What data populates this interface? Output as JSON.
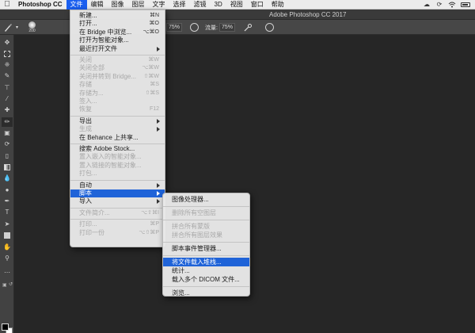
{
  "menubar": {
    "app_name": "Photoshop CC",
    "items": [
      "文件",
      "编辑",
      "图像",
      "图层",
      "文字",
      "选择",
      "滤镜",
      "3D",
      "视图",
      "窗口",
      "帮助"
    ],
    "active_index": 0
  },
  "titlebar": {
    "title": "Adobe Photoshop CC 2017"
  },
  "optionsbar": {
    "brush_size": "200",
    "opacity_value": "75%",
    "flow_label": "流量:",
    "flow_value": "75%"
  },
  "file_menu": {
    "items": [
      {
        "label": "新建...",
        "shortcut": "⌘N",
        "enabled": true
      },
      {
        "label": "打开...",
        "shortcut": "⌘O",
        "enabled": true
      },
      {
        "label": "在 Bridge 中浏览...",
        "shortcut": "⌥⌘O",
        "enabled": true
      },
      {
        "label": "打开为智能对象...",
        "shortcut": "",
        "enabled": true
      },
      {
        "label": "最近打开文件",
        "shortcut": "",
        "enabled": true,
        "submenu": true
      },
      {
        "separator": true
      },
      {
        "label": "关闭",
        "shortcut": "⌘W",
        "enabled": false
      },
      {
        "label": "关闭全部",
        "shortcut": "⌥⌘W",
        "enabled": false
      },
      {
        "label": "关闭并转到 Bridge...",
        "shortcut": "⇧⌘W",
        "enabled": false
      },
      {
        "label": "存储",
        "shortcut": "⌘S",
        "enabled": false
      },
      {
        "label": "存储为...",
        "shortcut": "⇧⌘S",
        "enabled": false
      },
      {
        "label": "签入...",
        "shortcut": "",
        "enabled": false
      },
      {
        "label": "恢复",
        "shortcut": "F12",
        "enabled": false
      },
      {
        "separator": true
      },
      {
        "label": "导出",
        "shortcut": "",
        "enabled": true,
        "submenu": true
      },
      {
        "label": "生成",
        "shortcut": "",
        "enabled": false,
        "submenu": true
      },
      {
        "label": "在 Behance 上共享...",
        "shortcut": "",
        "enabled": true
      },
      {
        "separator": true
      },
      {
        "label": "搜索 Adobe Stock...",
        "shortcut": "",
        "enabled": true
      },
      {
        "label": "置入嵌入的智能对象...",
        "shortcut": "",
        "enabled": false
      },
      {
        "label": "置入链接的智能对象...",
        "shortcut": "",
        "enabled": false
      },
      {
        "label": "打包...",
        "shortcut": "",
        "enabled": false
      },
      {
        "separator": true
      },
      {
        "label": "自动",
        "shortcut": "",
        "enabled": true,
        "submenu": true
      },
      {
        "label": "脚本",
        "shortcut": "",
        "enabled": true,
        "submenu": true,
        "highlighted": true
      },
      {
        "label": "导入",
        "shortcut": "",
        "enabled": true,
        "submenu": true
      },
      {
        "separator": true
      },
      {
        "label": "文件简介...",
        "shortcut": "⌥⇧⌘I",
        "enabled": false
      },
      {
        "separator": true
      },
      {
        "label": "打印...",
        "shortcut": "⌘P",
        "enabled": false
      },
      {
        "label": "打印一份",
        "shortcut": "⌥⇧⌘P",
        "enabled": false
      }
    ]
  },
  "script_menu": {
    "items": [
      {
        "label": "图像处理器...",
        "enabled": true
      },
      {
        "separator": true
      },
      {
        "label": "删除所有空图层",
        "enabled": false
      },
      {
        "separator": true
      },
      {
        "label": "拼合所有蒙版",
        "enabled": false
      },
      {
        "label": "拼合所有图层效果",
        "enabled": false
      },
      {
        "separator": true
      },
      {
        "label": "脚本事件管理器...",
        "enabled": true
      },
      {
        "separator": true
      },
      {
        "label": "将文件载入堆栈...",
        "enabled": true,
        "highlighted": true
      },
      {
        "label": "统计...",
        "enabled": true
      },
      {
        "label": "载入多个 DICOM 文件...",
        "enabled": true
      },
      {
        "separator": true
      },
      {
        "label": "浏览...",
        "enabled": true
      }
    ]
  },
  "toolbar": {
    "tools": [
      "move-tool-icon",
      "marquee-tool-icon",
      "lasso-tool-icon",
      "quick-select-tool-icon",
      "crop-tool-icon",
      "eyedropper-tool-icon",
      "healing-brush-icon",
      "brush-tool-icon",
      "clone-stamp-icon",
      "history-brush-icon",
      "eraser-tool-icon",
      "gradient-tool-icon",
      "blur-tool-icon",
      "dodge-tool-icon",
      "pen-tool-icon",
      "type-tool-icon",
      "path-select-icon",
      "rectangle-tool-icon",
      "hand-tool-icon",
      "zoom-tool-icon",
      "more-tools-icon"
    ],
    "selected_tool": "brush-tool-icon",
    "foreground_color": "#000000",
    "background_color": "#ffffff"
  },
  "colors": {
    "menu_highlight": "#1f63d8",
    "workspace": "#262626"
  }
}
